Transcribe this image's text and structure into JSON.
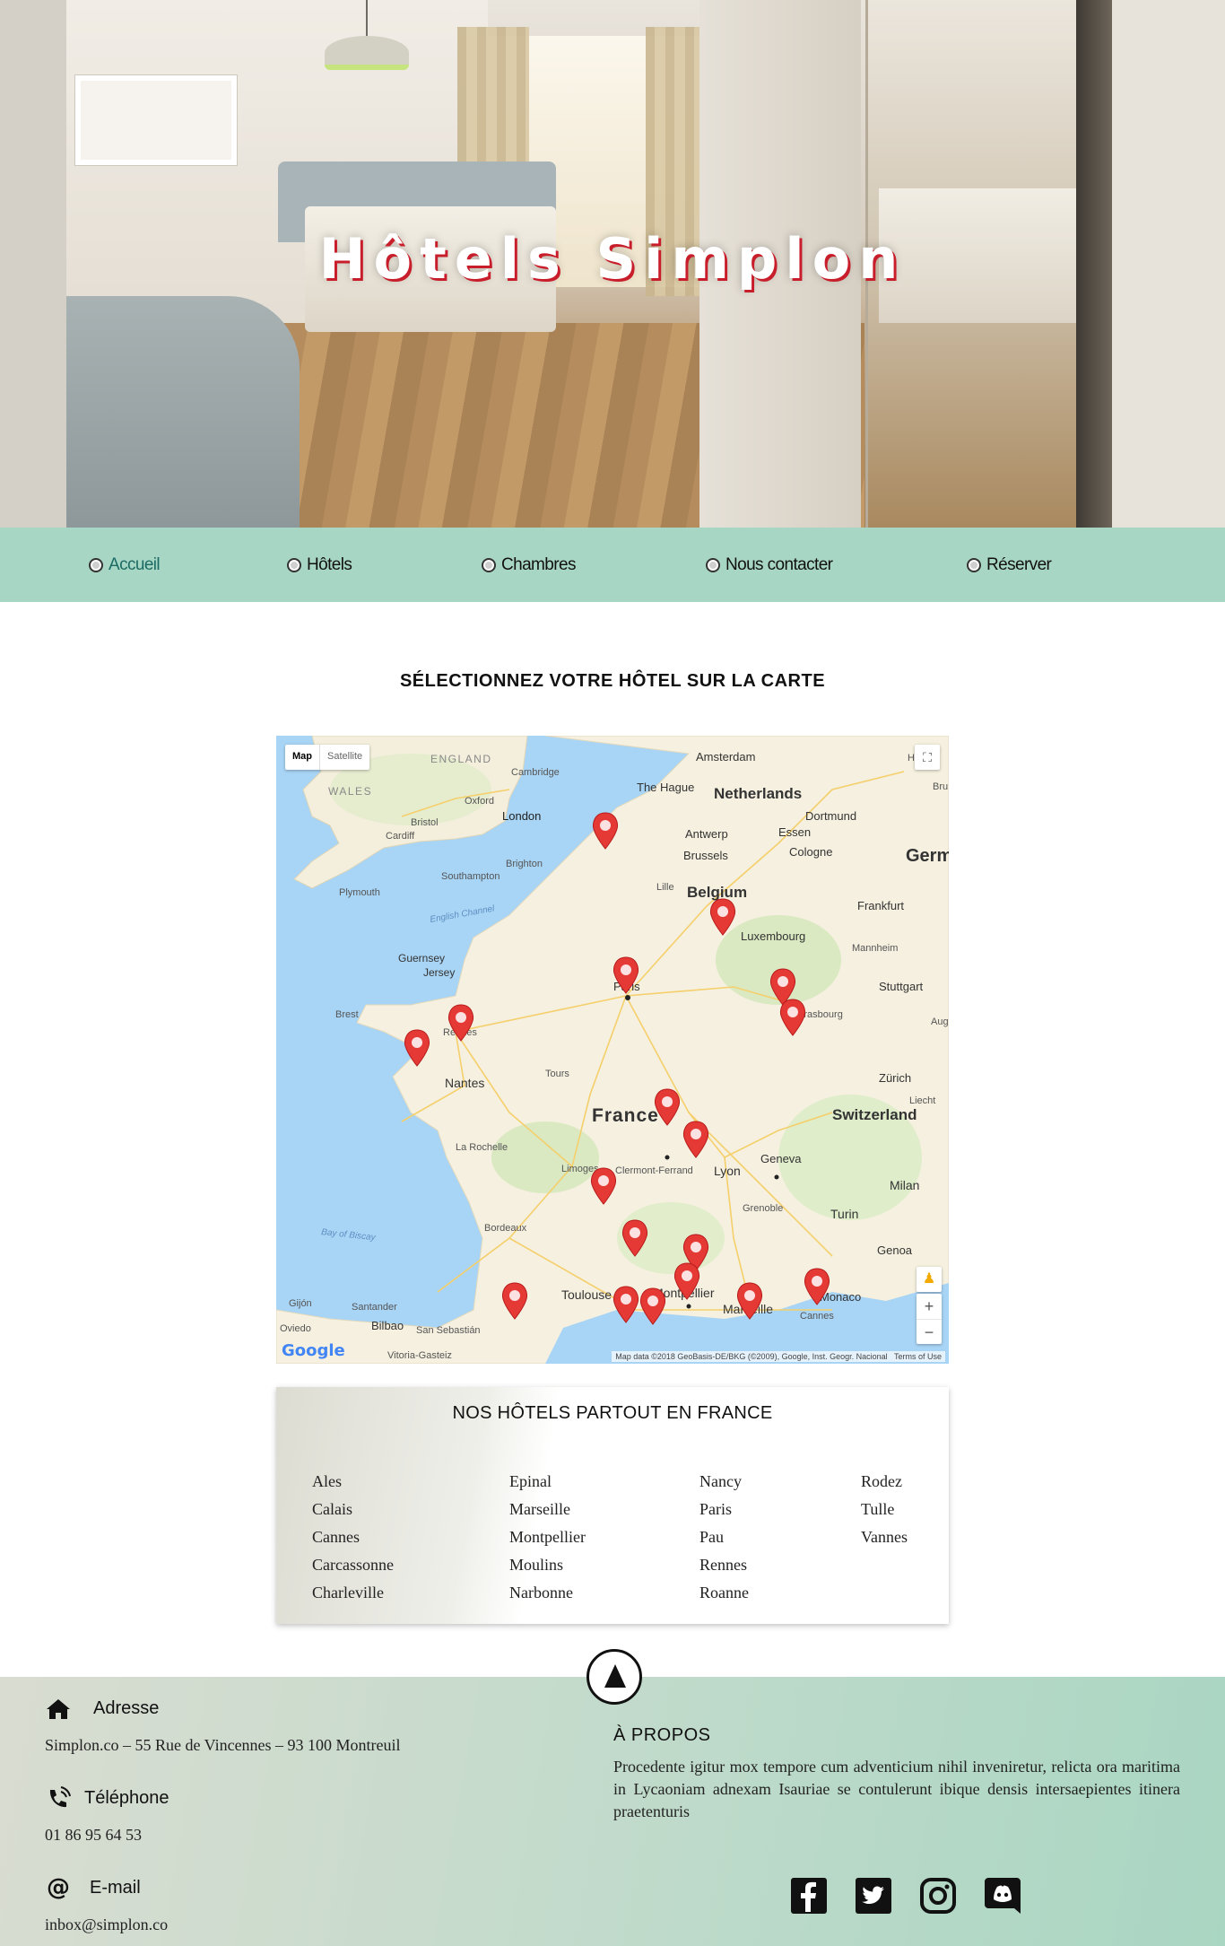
{
  "hero": {
    "title": "Hôtels Simplon"
  },
  "nav": {
    "items": [
      {
        "label": "Accueil",
        "active": true
      },
      {
        "label": "Hôtels",
        "active": false
      },
      {
        "label": "Chambres",
        "active": false
      },
      {
        "label": "Nous contacter",
        "active": false
      },
      {
        "label": "Réserver",
        "active": false
      }
    ]
  },
  "map_section": {
    "title": "SÉLECTIONNEZ VOTRE HÔTEL SUR LA CARTE",
    "map_type_buttons": {
      "map": "Map",
      "satellite": "Satellite"
    },
    "zoom_in": "+",
    "zoom_out": "−",
    "google_logo": "Google",
    "attribution": "Map data ©2018 GeoBasis-DE/BKG (©2009), Google, Inst. Geogr. Nacional",
    "terms": "Terms of Use",
    "labels": {
      "england": "ENGLAND",
      "wales": "WALES",
      "cambridge": "Cambridge",
      "oxford": "Oxford",
      "london": "London",
      "bristol": "Bristol",
      "cardiff": "Cardiff",
      "brighton": "Brighton",
      "southampton": "Southampton",
      "plymouth": "Plymouth",
      "english_channel": "English Channel",
      "guernsey": "Guernsey",
      "jersey": "Jersey",
      "amsterdam": "Amsterdam",
      "the_hague": "The Hague",
      "netherlands": "Netherlands",
      "dortmund": "Dortmund",
      "essen": "Essen",
      "antwerp": "Antwerp",
      "brussels": "Brussels",
      "cologne": "Cologne",
      "germany": "Germ",
      "lille": "Lille",
      "belgium": "Belgium",
      "frankfurt": "Frankfurt",
      "luxembourg": "Luxembourg",
      "mannheim": "Mannheim",
      "stuttgart": "Stuttgart",
      "paris": "Paris",
      "strasbourg": "Strasbourg",
      "brest": "Brest",
      "rennes": "Rennes",
      "nantes": "Nantes",
      "tours": "Tours",
      "france": "France",
      "zurich": "Zürich",
      "switzerland": "Switzerland",
      "la_rochelle": "La Rochelle",
      "limoges": "Limoges",
      "clermont": "Clermont-Ferrand",
      "lyon": "Lyon",
      "geneva": "Geneva",
      "grenoble": "Grenoble",
      "milan": "Milan",
      "turin": "Turin",
      "bay_of_biscay": "Bay of Biscay",
      "bordeaux": "Bordeaux",
      "genoa": "Genoa",
      "toulouse": "Toulouse",
      "montpellier": "Montpellier",
      "marseille": "Marseille",
      "monaco": "Monaco",
      "cannes": "Cannes",
      "gijon": "Gijón",
      "oviedo": "Oviedo",
      "santander": "Santander",
      "bilbao": "Bilbao",
      "san_sebastian": "San Sebastián",
      "vitoria": "Vitoria-Gasteiz",
      "liecht": "Liecht",
      "augs": "Augs",
      "bru": "Bru",
      "ha": "Ha"
    }
  },
  "hotels": {
    "title": "NOS HÔTELS PARTOUT EN FRANCE",
    "columns": [
      [
        "Ales",
        "Calais",
        "Cannes",
        "Carcassonne",
        "Charleville"
      ],
      [
        "Epinal",
        "Marseille",
        "Montpellier",
        "Moulins",
        "Narbonne"
      ],
      [
        "Nancy",
        "Paris",
        "Pau",
        "Rennes",
        "Roanne"
      ],
      [
        "Rodez",
        "Tulle",
        "Vannes"
      ]
    ]
  },
  "footer": {
    "address_label": "Adresse",
    "address_value": "Simplon.co – 55 Rue de Vincennes – 93 100 Montreuil",
    "phone_label": "Téléphone",
    "phone_value": "01 86 95 64 53",
    "email_label": "E-mail",
    "email_value": "inbox@simplon.co",
    "about_title": "À PROPOS",
    "about_text": "Procedente igitur mox tempore cum adventicium nihil inveniretur, relicta ora maritima in Lycaoniam adnexam Isauriae se contulerunt ibique densis intersaepientes itinera praetenturis",
    "social": [
      "facebook-icon",
      "twitter-icon",
      "instagram-icon",
      "discord-icon"
    ]
  },
  "colors": {
    "nav_bg": "#a8d6c4",
    "nav_active": "#1b6b64",
    "title_shadow": "#c81e2b",
    "marker": "#e53935"
  }
}
